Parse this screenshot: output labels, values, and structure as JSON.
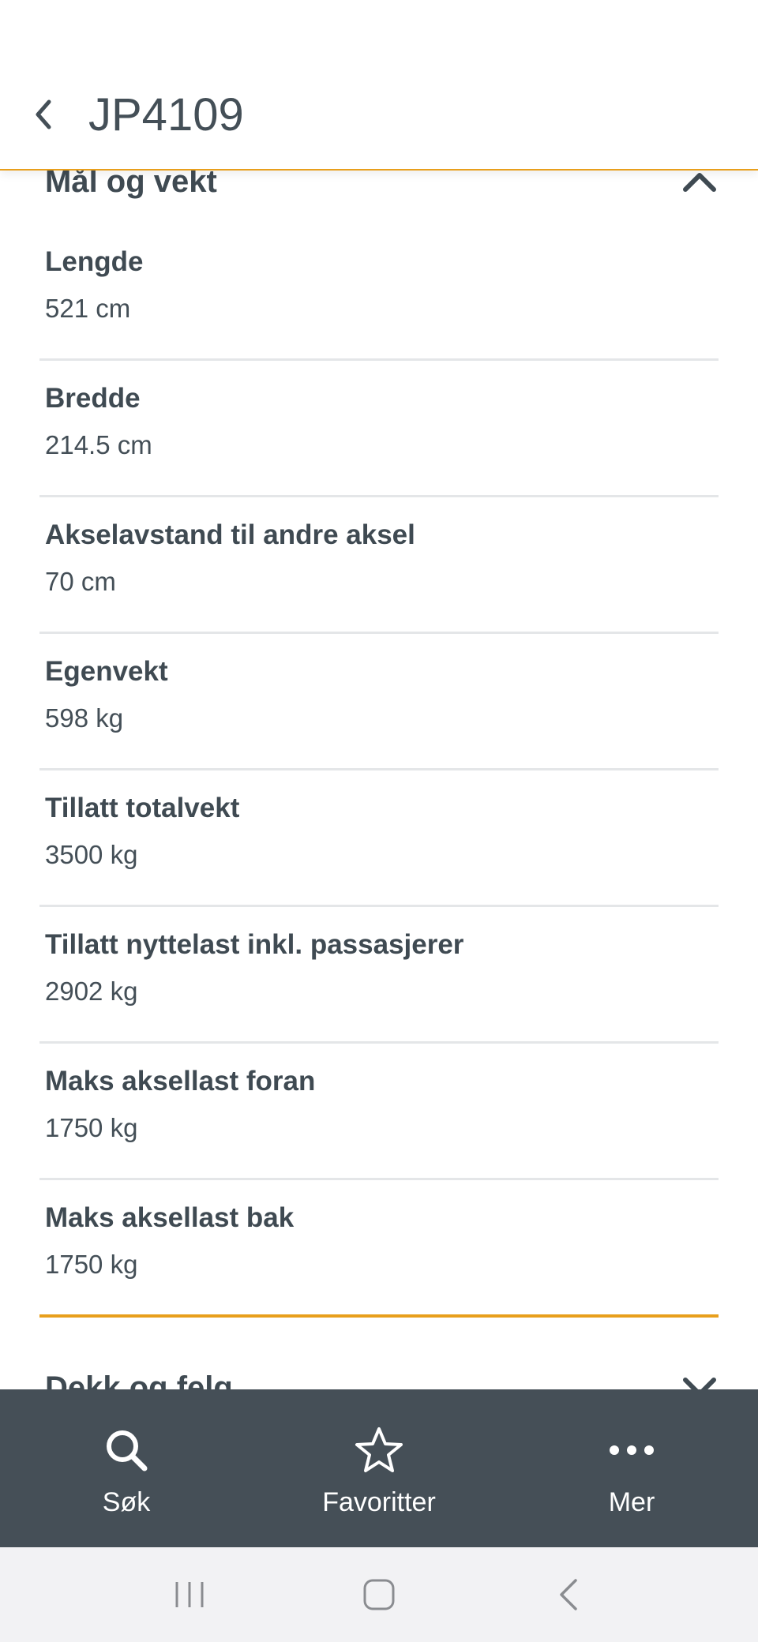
{
  "header": {
    "title": "JP4109"
  },
  "section": {
    "title": "Mål og vekt"
  },
  "rows": [
    {
      "label": "Lengde",
      "value": "521 cm"
    },
    {
      "label": "Bredde",
      "value": "214.5 cm"
    },
    {
      "label": "Akselavstand til andre aksel",
      "value": "70 cm"
    },
    {
      "label": "Egenvekt",
      "value": "598 kg"
    },
    {
      "label": "Tillatt totalvekt",
      "value": "3500 kg"
    },
    {
      "label": "Tillatt nyttelast inkl. passasjerer",
      "value": "2902 kg"
    },
    {
      "label": "Maks aksellast foran",
      "value": "1750 kg"
    },
    {
      "label": "Maks aksellast bak",
      "value": "1750 kg"
    }
  ],
  "next_section": {
    "title": "Dekk og felg"
  },
  "tabbar": {
    "items": [
      {
        "label": "Søk",
        "icon": "search-icon"
      },
      {
        "label": "Favoritter",
        "icon": "star-icon"
      },
      {
        "label": "Mer",
        "icon": "more-icon"
      }
    ]
  },
  "colors": {
    "accent": "#e89f1c",
    "tabbar": "#454f57",
    "text": "#444f57"
  }
}
